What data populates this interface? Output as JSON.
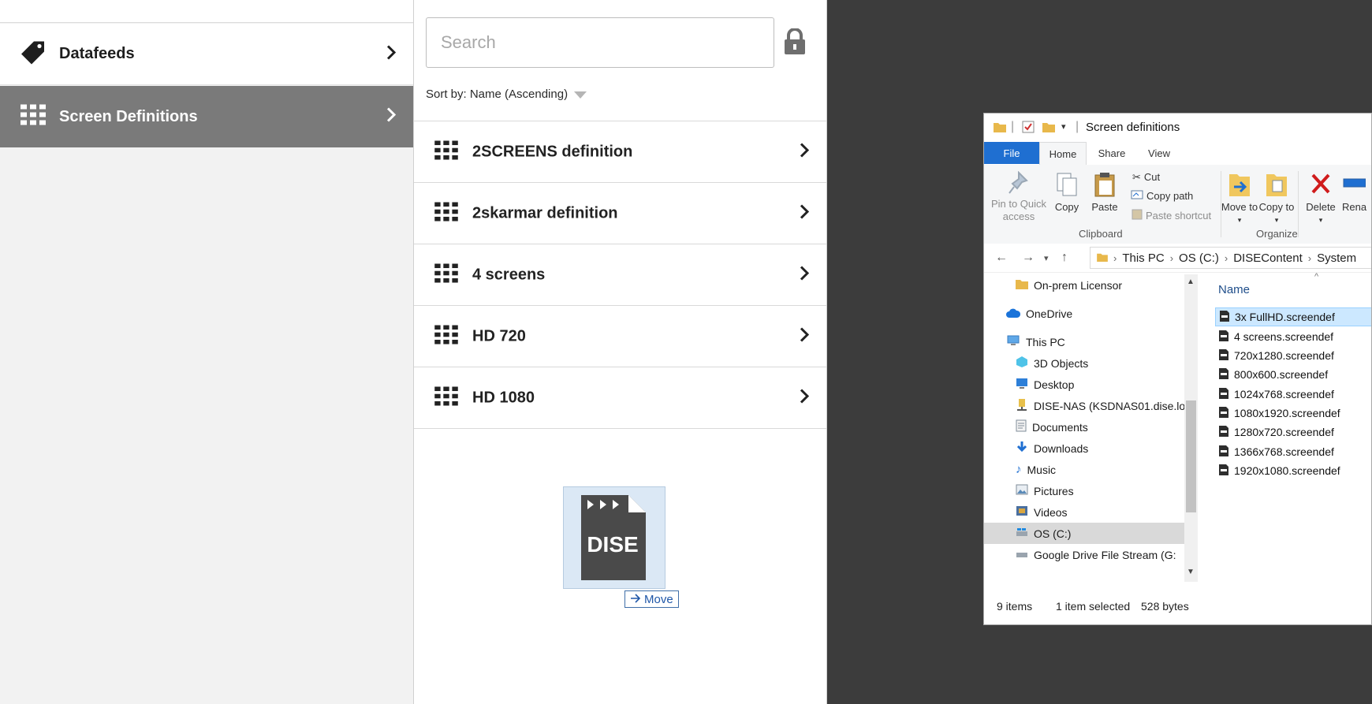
{
  "nav": {
    "items": [
      {
        "label": "Datafeeds",
        "icon": "tag-icon"
      },
      {
        "label": "Screen Definitions",
        "icon": "grid-icon",
        "active": true
      }
    ]
  },
  "list": {
    "search_placeholder": "Search",
    "sort_label": "Sort by: Name (Ascending)",
    "items": [
      {
        "label": "2SCREENS definition"
      },
      {
        "label": "2skarmar definition"
      },
      {
        "label": "4 screens"
      },
      {
        "label": "HD 720"
      },
      {
        "label": "HD 1080"
      }
    ]
  },
  "drag": {
    "move_label": "Move",
    "ghost_text": "DISE"
  },
  "explorer": {
    "title": "Screen definitions",
    "tabs": {
      "file": "File",
      "home": "Home",
      "share": "Share",
      "view": "View"
    },
    "ribbon": {
      "pin": "Pin to Quick access",
      "copy": "Copy",
      "paste": "Paste",
      "cut": "Cut",
      "copy_path": "Copy path",
      "paste_shortcut": "Paste shortcut",
      "move_to": "Move to",
      "copy_to": "Copy to",
      "delete": "Delete",
      "rename": "Rena",
      "group_clipboard": "Clipboard",
      "group_organize": "Organize"
    },
    "breadcrumb": [
      "This PC",
      "OS (C:)",
      "DISEContent",
      "System"
    ],
    "tree": [
      {
        "label": "On-prem Licensor",
        "icon": "folder-icon"
      },
      {
        "label": "OneDrive",
        "icon": "cloud-icon"
      },
      {
        "label": "This PC",
        "icon": "computer-icon"
      },
      {
        "label": "3D Objects",
        "icon": "cube-icon"
      },
      {
        "label": "Desktop",
        "icon": "desktop-icon"
      },
      {
        "label": "DISE-NAS (KSDNAS01.dise.lo",
        "icon": "network-drive-icon"
      },
      {
        "label": "Documents",
        "icon": "documents-icon"
      },
      {
        "label": "Downloads",
        "icon": "download-icon"
      },
      {
        "label": "Music",
        "icon": "music-icon"
      },
      {
        "label": "Pictures",
        "icon": "pictures-icon"
      },
      {
        "label": "Videos",
        "icon": "videos-icon"
      },
      {
        "label": "OS (C:)",
        "icon": "drive-icon",
        "selected": true
      },
      {
        "label": "Google Drive File Stream (G:",
        "icon": "drive-icon"
      }
    ],
    "column_name": "Name",
    "files": [
      {
        "name": "3x FullHD.screendef",
        "selected": true
      },
      {
        "name": "4 screens.screendef"
      },
      {
        "name": "720x1280.screendef"
      },
      {
        "name": "800x600.screendef"
      },
      {
        "name": "1024x768.screendef"
      },
      {
        "name": "1080x1920.screendef"
      },
      {
        "name": "1280x720.screendef"
      },
      {
        "name": "1366x768.screendef"
      },
      {
        "name": "1920x1080.screendef"
      }
    ],
    "status": {
      "items": "9 items",
      "selected": "1 item selected",
      "size": "528 bytes"
    }
  },
  "colors": {
    "active_nav": "#7a7a7a",
    "file_tab": "#1f6fd1",
    "selection": "#cce8ff",
    "desktop": "#3c3c3c"
  }
}
